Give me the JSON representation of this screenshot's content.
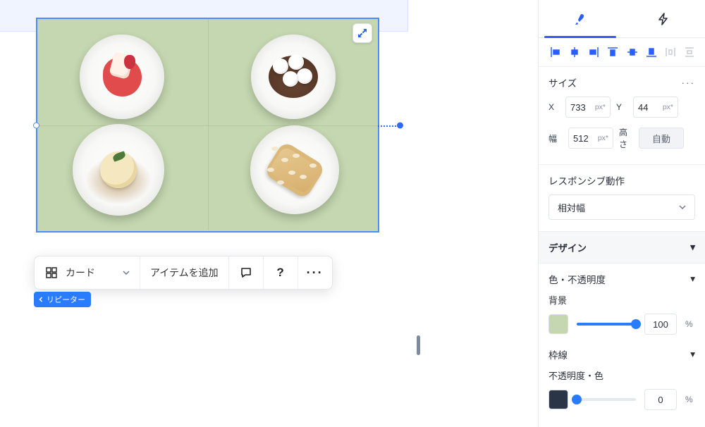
{
  "toolbar": {
    "dropdown_label": "カード",
    "add_item_label": "アイテムを追加"
  },
  "repeater_tag": "リピーター",
  "panel": {
    "size_label": "サイズ",
    "x_label": "X",
    "x_value": "733",
    "x_unit": "px*",
    "y_label": "Y",
    "y_value": "44",
    "y_unit": "px*",
    "width_label": "幅",
    "width_value": "512",
    "width_unit": "px*",
    "height_label": "高さ",
    "height_value": "自動",
    "responsive_label": "レスポンシブ動作",
    "responsive_value": "相対幅",
    "design_label": "デザイン",
    "color_opacity_label": "色・不透明度",
    "background_label": "背景",
    "background_color": "#c4d7b0",
    "background_opacity": "100",
    "border_label": "枠線",
    "border_opacity_color_label": "不透明度・色",
    "border_color": "#2a3548",
    "border_opacity": "0",
    "percent": "%"
  }
}
